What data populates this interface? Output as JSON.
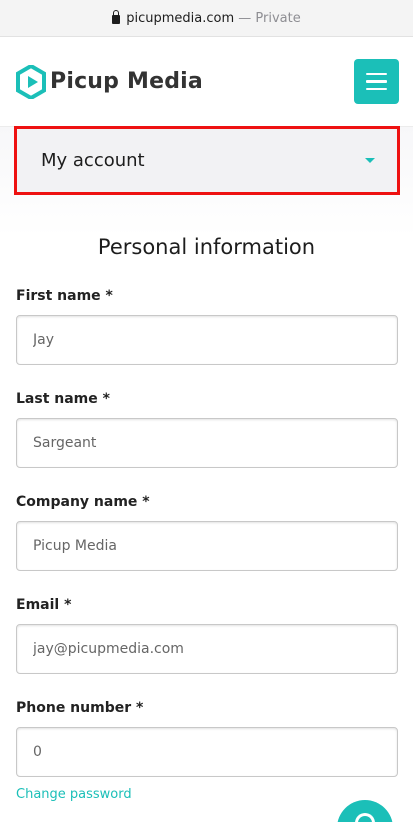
{
  "browser": {
    "domain": "picupmedia.com",
    "separator": " — ",
    "mode": "Private"
  },
  "brand": {
    "name": "Picup Media",
    "color": "#1bbfb8"
  },
  "header": {
    "menu_icon": "hamburger-icon"
  },
  "account_menu": {
    "label": "My account",
    "highlight_color": "#ee1111"
  },
  "section": {
    "title": "Personal information"
  },
  "fields": {
    "first_name": {
      "label": "First name *",
      "value": "Jay"
    },
    "last_name": {
      "label": "Last name *",
      "value": "Sargeant"
    },
    "company_name": {
      "label": "Company name *",
      "value": "Picup Media"
    },
    "email": {
      "label": "Email *",
      "value": "jay@picupmedia.com"
    },
    "phone_number": {
      "label": "Phone number *",
      "value": "0"
    }
  },
  "links": {
    "change_password": "Change password"
  },
  "chat": {
    "icon": "chat-icon"
  }
}
